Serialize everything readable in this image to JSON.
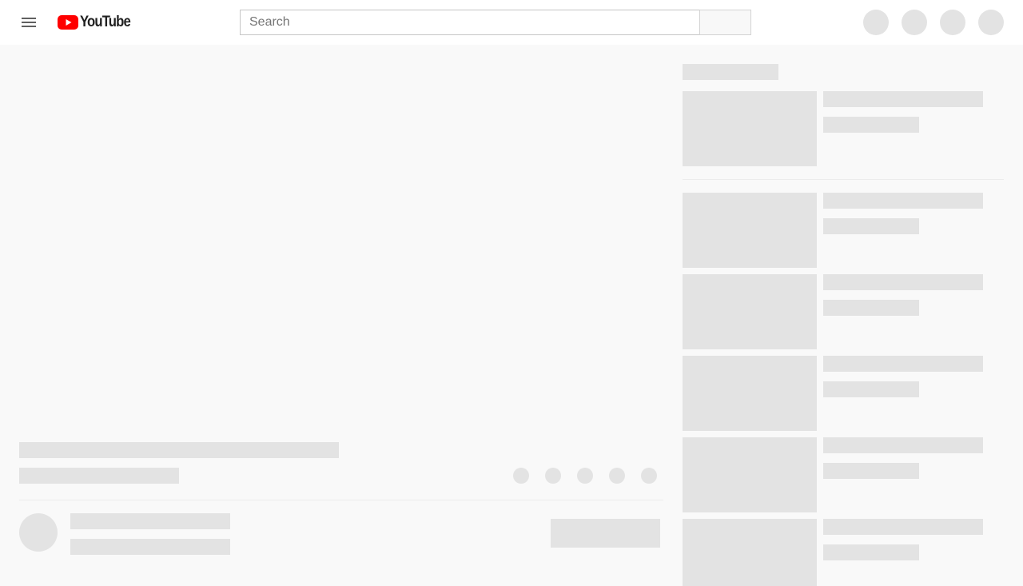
{
  "masthead": {
    "logo_text": "YouTube",
    "search": {
      "placeholder": "Search",
      "value": ""
    },
    "icons": {
      "menu": "hamburger-menu-icon",
      "logo": "youtube-play-logo-icon"
    },
    "brand_color": "#ff0000"
  },
  "colors": {
    "background": "#f9f9f9",
    "placeholder": "#e3e3e3",
    "masthead": "#ffffff"
  }
}
